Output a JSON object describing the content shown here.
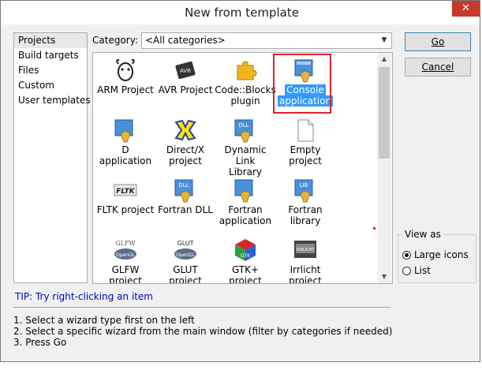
{
  "window": {
    "title": "New from template",
    "close": "✕"
  },
  "tree": [
    "Projects",
    "Build targets",
    "Files",
    "Custom",
    "User templates"
  ],
  "category": {
    "label": "Category:",
    "value": "<All categories>"
  },
  "templates": [
    {
      "l1": "ARM Project",
      "l2": ""
    },
    {
      "l1": "AVR Project",
      "l2": ""
    },
    {
      "l1": "Code::Blocks",
      "l2": "plugin"
    },
    {
      "l1": "Console",
      "l2": "application"
    },
    {
      "l1": "D application",
      "l2": ""
    },
    {
      "l1": "Direct/X",
      "l2": "project"
    },
    {
      "l1": "Dynamic Link",
      "l2": "Library"
    },
    {
      "l1": "Empty",
      "l2": "project"
    },
    {
      "l1": "FLTK project",
      "l2": ""
    },
    {
      "l1": "Fortran DLL",
      "l2": ""
    },
    {
      "l1": "Fortran",
      "l2": "application"
    },
    {
      "l1": "Fortran",
      "l2": "library"
    },
    {
      "l1": "GLFW",
      "l2": "project"
    },
    {
      "l1": "GLUT",
      "l2": "project"
    },
    {
      "l1": "GTK+",
      "l2": "project"
    },
    {
      "l1": "Irrlicht",
      "l2": "project"
    }
  ],
  "icon_text": {
    "avr": "AVR",
    "dll": "DLL",
    "lib": "LIB",
    "fltk": "FLTK",
    "glfw1": "GLFW",
    "glfw2": "OpenGL",
    "glut1": "GLUT",
    "glut2": "OpenGL",
    "gtk": "GTK",
    "irr": "IRRLICHT"
  },
  "tip": "TIP: Try right-clicking an item",
  "instructions": [
    "1. Select a wizard type first on the left",
    "2. Select a specific wizard from the main window (filter by categories if needed)",
    "3. Press Go"
  ],
  "buttons": {
    "go": "Go",
    "cancel": "Cancel"
  },
  "view_as": {
    "title": "View as",
    "large": "Large icons",
    "list": "List"
  },
  "colors": {
    "selection": "#3399ff",
    "highlight_box": "#d9232d",
    "tip": "#0000c8"
  }
}
